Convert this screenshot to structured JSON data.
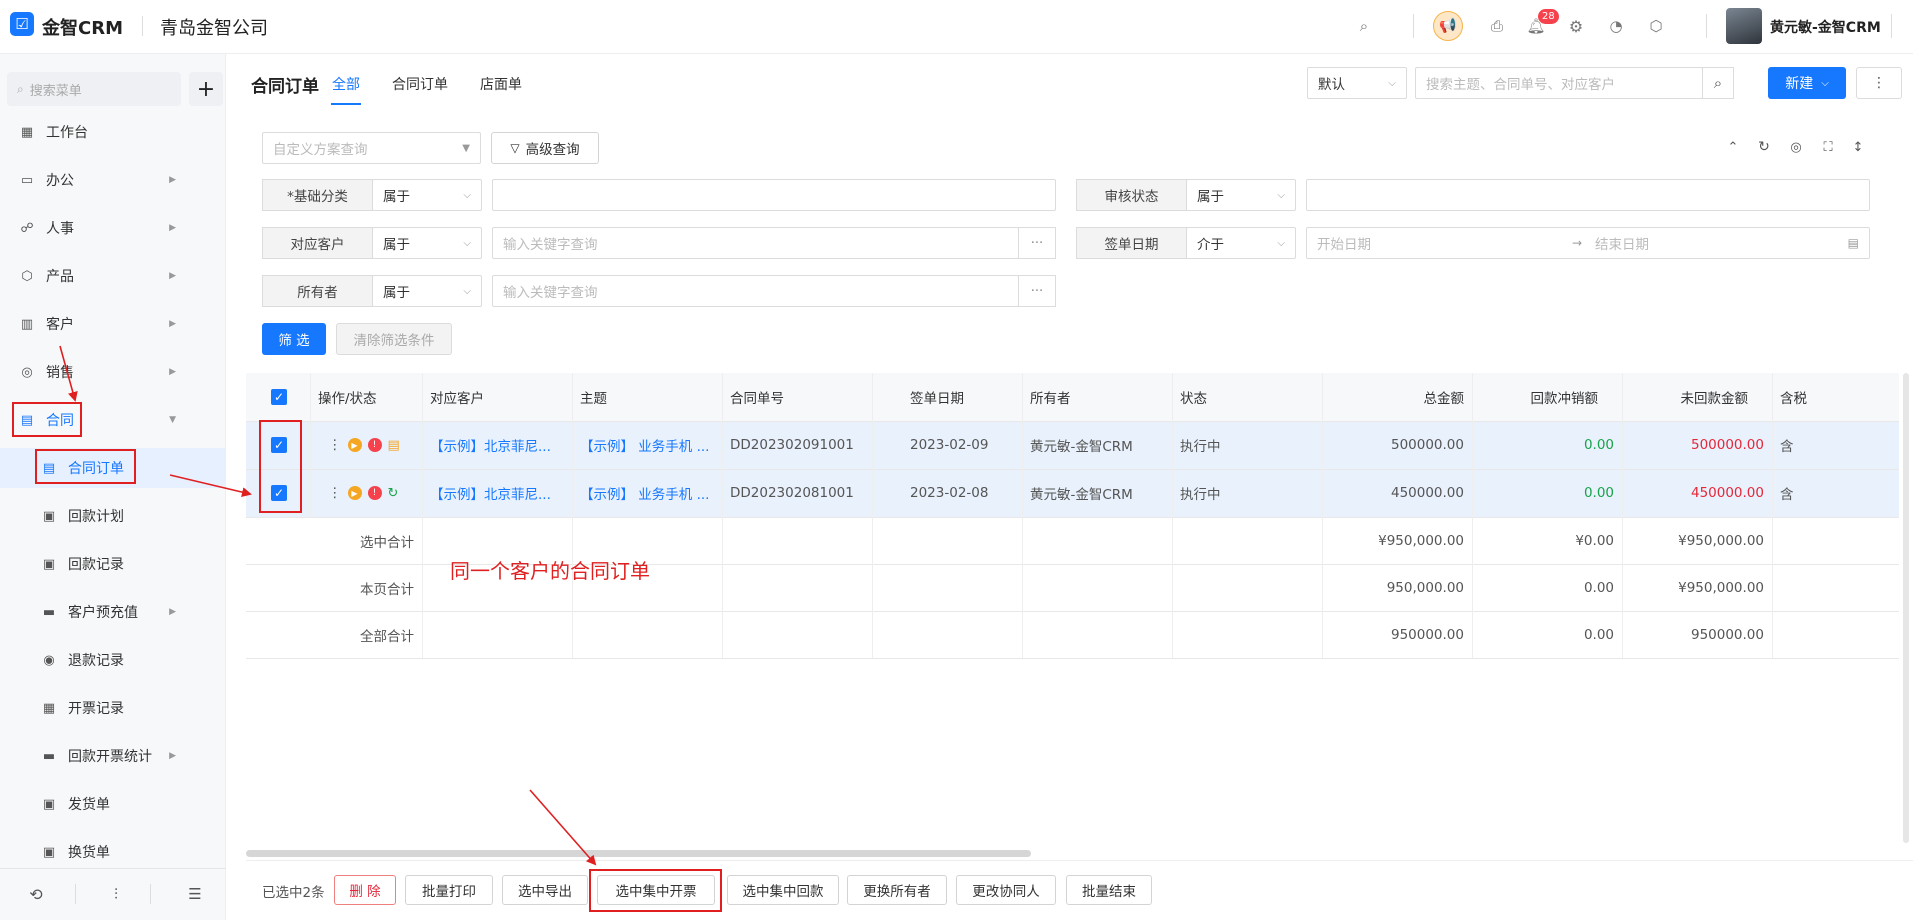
{
  "topbar": {
    "logo_text": "金智CRM",
    "company": "青岛金智公司",
    "notif_count": "28",
    "user_name": "黄元敏-金智CRM"
  },
  "sidebar": {
    "search_placeholder": "搜索菜单",
    "add_label": "+",
    "items": [
      {
        "label": "工作台"
      },
      {
        "label": "办公"
      },
      {
        "label": "人事"
      },
      {
        "label": "产品"
      },
      {
        "label": "客户"
      },
      {
        "label": "销售"
      },
      {
        "label": "合同"
      }
    ],
    "subitems": [
      {
        "label": "合同订单"
      },
      {
        "label": "回款计划"
      },
      {
        "label": "回款记录"
      },
      {
        "label": "客户预充值"
      },
      {
        "label": "退款记录"
      },
      {
        "label": "开票记录"
      },
      {
        "label": "回款开票统计"
      },
      {
        "label": "发货单"
      },
      {
        "label": "换货单"
      }
    ]
  },
  "header": {
    "title": "合同订单",
    "tabs": [
      "全部",
      "合同订单",
      "店面单"
    ],
    "view_select": "默认",
    "search_placeholder": "搜索主题、合同单号、对应客户",
    "new_button": "新建"
  },
  "filter": {
    "scheme_placeholder": "自定义方案查询",
    "advanced_label": "高级查询",
    "rows": {
      "category_label": "*基础分类",
      "category_op": "属于",
      "audit_label": "审核状态",
      "audit_op": "属于",
      "customer_label": "对应客户",
      "customer_op": "属于",
      "customer_placeholder": "输入关键字查询",
      "date_label": "签单日期",
      "date_op": "介于",
      "date_start": "开始日期",
      "date_end": "结束日期",
      "owner_label": "所有者",
      "owner_op": "属于",
      "owner_placeholder": "输入关键字查询",
      "more": "···"
    },
    "filter_button": "筛 选",
    "clear_button": "清除筛选条件"
  },
  "table": {
    "headers": [
      "操作/状态",
      "对应客户",
      "主题",
      "合同单号",
      "签单日期",
      "所有者",
      "状态",
      "总金额",
      "回款冲销额",
      "未回款金额",
      "含税"
    ],
    "rows": [
      {
        "customer": "【示例】北京菲尼...",
        "subject": "【示例】 业务手机 ...",
        "no": "DD202302091001",
        "date": "2023-02-09",
        "owner": "黄元敏-金智CRM",
        "status": "执行中",
        "total": "500000.00",
        "writeoff": "0.00",
        "unpaid": "500000.00",
        "tax": "含"
      },
      {
        "customer": "【示例】北京菲尼...",
        "subject": "【示例】 业务手机 ...",
        "no": "DD202302081001",
        "date": "2023-02-08",
        "owner": "黄元敏-金智CRM",
        "status": "执行中",
        "total": "450000.00",
        "writeoff": "0.00",
        "unpaid": "450000.00",
        "tax": "含"
      }
    ],
    "summary": [
      {
        "label": "选中合计",
        "total": "¥950,000.00",
        "writeoff": "¥0.00",
        "unpaid": "¥950,000.00"
      },
      {
        "label": "本页合计",
        "total": "950,000.00",
        "writeoff": "0.00",
        "unpaid": "¥950,000.00"
      },
      {
        "label": "全部合计",
        "total": "950000.00",
        "writeoff": "0.00",
        "unpaid": "950000.00"
      }
    ]
  },
  "annotation": "同一个客户的合同订单",
  "bottom": {
    "selected": "已选中2条",
    "buttons": [
      "删 除",
      "批量打印",
      "选中导出",
      "选中集中开票",
      "选中集中回款",
      "更换所有者",
      "更改协同人",
      "批量结束"
    ]
  },
  "colors": {
    "accent": "#1677ff",
    "red": "#e02020",
    "green": "#19a34a"
  }
}
